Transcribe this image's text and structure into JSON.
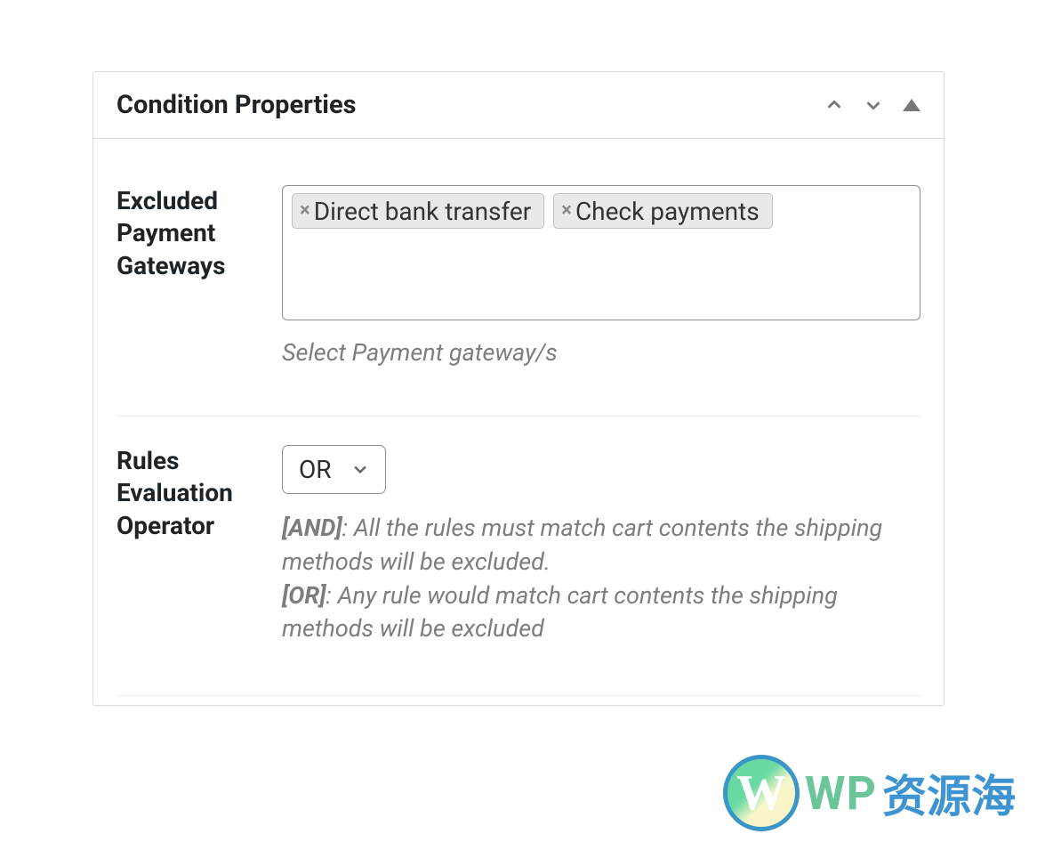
{
  "panel": {
    "title": "Condition Properties"
  },
  "excluded_gateways": {
    "label": "Excluded Payment Gateways",
    "tags": [
      "Direct bank transfer",
      "Check payments"
    ],
    "hint": "Select Payment gateway/s"
  },
  "rules_operator": {
    "label": "Rules Evaluation Operator",
    "value": "OR",
    "desc_and_label": "[AND]",
    "desc_and_text": ": All the rules must match cart contents the shipping methods will be excluded.",
    "desc_or_label": "[OR]",
    "desc_or_text": ": Any rule would match cart contents the shipping methods will be excluded"
  },
  "logo": {
    "wp": "WP",
    "cn": "资源海",
    "w": "W"
  }
}
